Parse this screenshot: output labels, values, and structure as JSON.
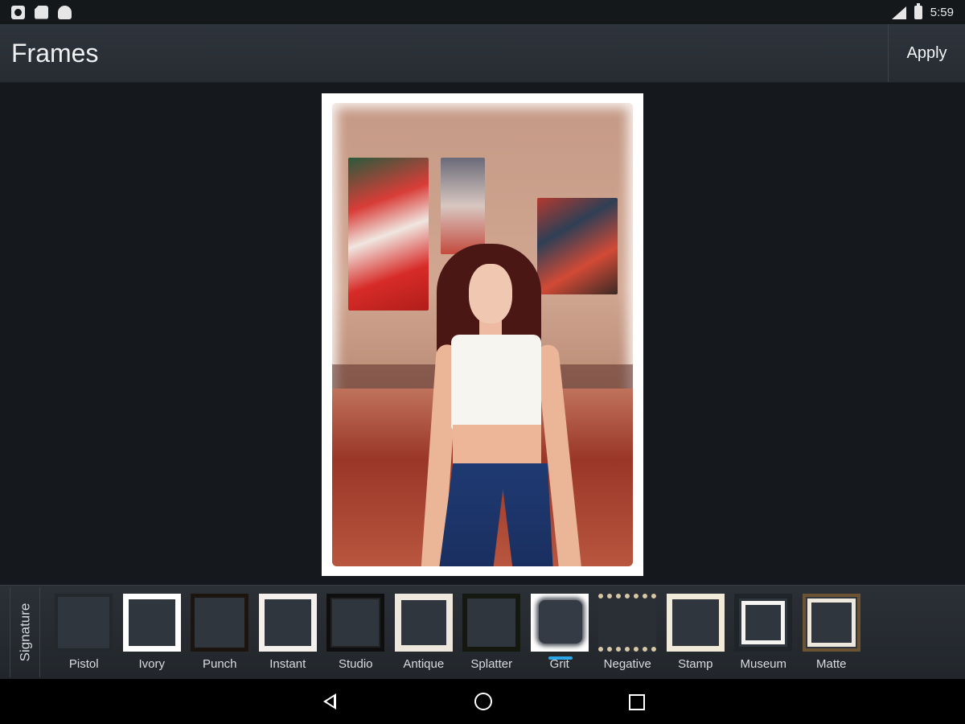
{
  "status_bar": {
    "time": "5:59"
  },
  "app_bar": {
    "title": "Frames",
    "apply_label": "Apply"
  },
  "frame_strip": {
    "category": "Signature",
    "selected": "Grit",
    "frames": [
      {
        "label": "Pistol"
      },
      {
        "label": "Ivory"
      },
      {
        "label": "Punch"
      },
      {
        "label": "Instant"
      },
      {
        "label": "Studio"
      },
      {
        "label": "Antique"
      },
      {
        "label": "Splatter"
      },
      {
        "label": "Grit"
      },
      {
        "label": "Negative"
      },
      {
        "label": "Stamp"
      },
      {
        "label": "Museum"
      },
      {
        "label": "Matte"
      }
    ]
  },
  "colors": {
    "accent": "#2aa6e8",
    "app_bar": "#2e343c",
    "background": "#16191d"
  },
  "icons": {
    "status_left": [
      "gallery-icon",
      "sd-card-icon",
      "android-icon"
    ],
    "status_right": [
      "signal-icon",
      "battery-icon"
    ],
    "nav": [
      "back-icon",
      "home-icon",
      "recent-apps-icon"
    ]
  }
}
